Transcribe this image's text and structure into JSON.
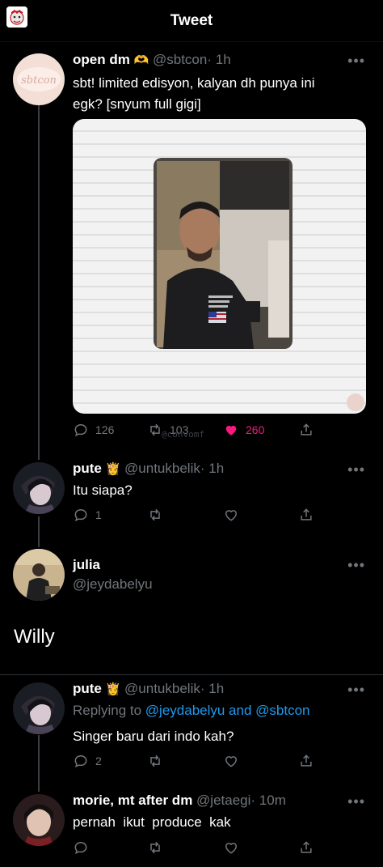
{
  "header": {
    "title": "Tweet"
  },
  "tweets": [
    {
      "name": "open dm",
      "badge": "🫶",
      "handle": "@sbtcon",
      "time": "· 1h",
      "more": "•••",
      "text_line1": "sbt! limited edisyon, kalyan dh punya ini",
      "text_line2": "egk? [snyum full gigi]",
      "avatar_text": "sbtcon",
      "stats": {
        "replies": "126",
        "retweets": "103",
        "likes": "260"
      }
    },
    {
      "name": "pute",
      "badge": "👸",
      "handle": "@untukbelik",
      "time": "· 1h",
      "more": "•••",
      "text": "Itu siapa?",
      "stats": {
        "replies": "1"
      }
    },
    {
      "name": "julia",
      "handle": "@jeydabelyu",
      "more": "•••",
      "text": "Willy"
    },
    {
      "name": "pute",
      "badge": "👸",
      "handle": "@untukbelik",
      "time": "· 1h",
      "more": "•••",
      "replying_prefix": "Replying to",
      "replying_users": "@jeydabelyu and @sbtcon",
      "text": "Singer baru dari indo kah?",
      "stats": {
        "replies": "2"
      }
    },
    {
      "name": "morie, mt after dm",
      "handle": "@jetaegi",
      "time": "· 10m",
      "more": "•••",
      "text": "pernah  ikut  produce  kak"
    }
  ],
  "watermark": "@convomf",
  "colors": {
    "like": "#f91880",
    "link": "#1d9bf0",
    "muted": "#71767b"
  },
  "icons": [
    "reply-icon",
    "retweet-icon",
    "heart-icon",
    "share-icon",
    "more-icon"
  ]
}
